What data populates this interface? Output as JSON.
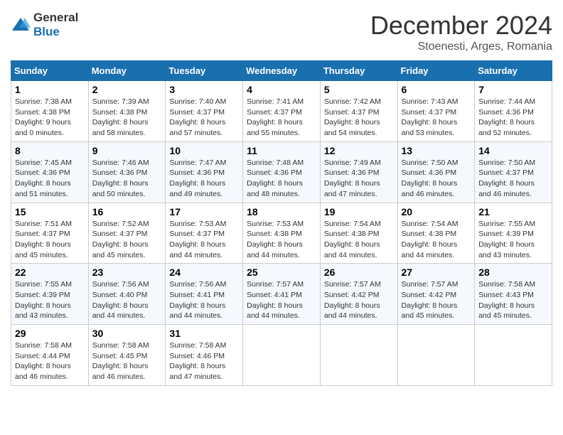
{
  "header": {
    "logo_general": "General",
    "logo_blue": "Blue",
    "month_title": "December 2024",
    "location": "Stoenesti, Arges, Romania"
  },
  "weekdays": [
    "Sunday",
    "Monday",
    "Tuesday",
    "Wednesday",
    "Thursday",
    "Friday",
    "Saturday"
  ],
  "weeks": [
    [
      {
        "day": 1,
        "sunrise": "Sunrise: 7:38 AM",
        "sunset": "Sunset: 4:38 PM",
        "daylight": "Daylight: 9 hours and 0 minutes."
      },
      {
        "day": 2,
        "sunrise": "Sunrise: 7:39 AM",
        "sunset": "Sunset: 4:38 PM",
        "daylight": "Daylight: 8 hours and 58 minutes."
      },
      {
        "day": 3,
        "sunrise": "Sunrise: 7:40 AM",
        "sunset": "Sunset: 4:37 PM",
        "daylight": "Daylight: 8 hours and 57 minutes."
      },
      {
        "day": 4,
        "sunrise": "Sunrise: 7:41 AM",
        "sunset": "Sunset: 4:37 PM",
        "daylight": "Daylight: 8 hours and 55 minutes."
      },
      {
        "day": 5,
        "sunrise": "Sunrise: 7:42 AM",
        "sunset": "Sunset: 4:37 PM",
        "daylight": "Daylight: 8 hours and 54 minutes."
      },
      {
        "day": 6,
        "sunrise": "Sunrise: 7:43 AM",
        "sunset": "Sunset: 4:37 PM",
        "daylight": "Daylight: 8 hours and 53 minutes."
      },
      {
        "day": 7,
        "sunrise": "Sunrise: 7:44 AM",
        "sunset": "Sunset: 4:36 PM",
        "daylight": "Daylight: 8 hours and 52 minutes."
      }
    ],
    [
      {
        "day": 8,
        "sunrise": "Sunrise: 7:45 AM",
        "sunset": "Sunset: 4:36 PM",
        "daylight": "Daylight: 8 hours and 51 minutes."
      },
      {
        "day": 9,
        "sunrise": "Sunrise: 7:46 AM",
        "sunset": "Sunset: 4:36 PM",
        "daylight": "Daylight: 8 hours and 50 minutes."
      },
      {
        "day": 10,
        "sunrise": "Sunrise: 7:47 AM",
        "sunset": "Sunset: 4:36 PM",
        "daylight": "Daylight: 8 hours and 49 minutes."
      },
      {
        "day": 11,
        "sunrise": "Sunrise: 7:48 AM",
        "sunset": "Sunset: 4:36 PM",
        "daylight": "Daylight: 8 hours and 48 minutes."
      },
      {
        "day": 12,
        "sunrise": "Sunrise: 7:49 AM",
        "sunset": "Sunset: 4:36 PM",
        "daylight": "Daylight: 8 hours and 47 minutes."
      },
      {
        "day": 13,
        "sunrise": "Sunrise: 7:50 AM",
        "sunset": "Sunset: 4:36 PM",
        "daylight": "Daylight: 8 hours and 46 minutes."
      },
      {
        "day": 14,
        "sunrise": "Sunrise: 7:50 AM",
        "sunset": "Sunset: 4:37 PM",
        "daylight": "Daylight: 8 hours and 46 minutes."
      }
    ],
    [
      {
        "day": 15,
        "sunrise": "Sunrise: 7:51 AM",
        "sunset": "Sunset: 4:37 PM",
        "daylight": "Daylight: 8 hours and 45 minutes."
      },
      {
        "day": 16,
        "sunrise": "Sunrise: 7:52 AM",
        "sunset": "Sunset: 4:37 PM",
        "daylight": "Daylight: 8 hours and 45 minutes."
      },
      {
        "day": 17,
        "sunrise": "Sunrise: 7:53 AM",
        "sunset": "Sunset: 4:37 PM",
        "daylight": "Daylight: 8 hours and 44 minutes."
      },
      {
        "day": 18,
        "sunrise": "Sunrise: 7:53 AM",
        "sunset": "Sunset: 4:38 PM",
        "daylight": "Daylight: 8 hours and 44 minutes."
      },
      {
        "day": 19,
        "sunrise": "Sunrise: 7:54 AM",
        "sunset": "Sunset: 4:38 PM",
        "daylight": "Daylight: 8 hours and 44 minutes."
      },
      {
        "day": 20,
        "sunrise": "Sunrise: 7:54 AM",
        "sunset": "Sunset: 4:38 PM",
        "daylight": "Daylight: 8 hours and 44 minutes."
      },
      {
        "day": 21,
        "sunrise": "Sunrise: 7:55 AM",
        "sunset": "Sunset: 4:39 PM",
        "daylight": "Daylight: 8 hours and 43 minutes."
      }
    ],
    [
      {
        "day": 22,
        "sunrise": "Sunrise: 7:55 AM",
        "sunset": "Sunset: 4:39 PM",
        "daylight": "Daylight: 8 hours and 43 minutes."
      },
      {
        "day": 23,
        "sunrise": "Sunrise: 7:56 AM",
        "sunset": "Sunset: 4:40 PM",
        "daylight": "Daylight: 8 hours and 44 minutes."
      },
      {
        "day": 24,
        "sunrise": "Sunrise: 7:56 AM",
        "sunset": "Sunset: 4:41 PM",
        "daylight": "Daylight: 8 hours and 44 minutes."
      },
      {
        "day": 25,
        "sunrise": "Sunrise: 7:57 AM",
        "sunset": "Sunset: 4:41 PM",
        "daylight": "Daylight: 8 hours and 44 minutes."
      },
      {
        "day": 26,
        "sunrise": "Sunrise: 7:57 AM",
        "sunset": "Sunset: 4:42 PM",
        "daylight": "Daylight: 8 hours and 44 minutes."
      },
      {
        "day": 27,
        "sunrise": "Sunrise: 7:57 AM",
        "sunset": "Sunset: 4:42 PM",
        "daylight": "Daylight: 8 hours and 45 minutes."
      },
      {
        "day": 28,
        "sunrise": "Sunrise: 7:58 AM",
        "sunset": "Sunset: 4:43 PM",
        "daylight": "Daylight: 8 hours and 45 minutes."
      }
    ],
    [
      {
        "day": 29,
        "sunrise": "Sunrise: 7:58 AM",
        "sunset": "Sunset: 4:44 PM",
        "daylight": "Daylight: 8 hours and 46 minutes."
      },
      {
        "day": 30,
        "sunrise": "Sunrise: 7:58 AM",
        "sunset": "Sunset: 4:45 PM",
        "daylight": "Daylight: 8 hours and 46 minutes."
      },
      {
        "day": 31,
        "sunrise": "Sunrise: 7:58 AM",
        "sunset": "Sunset: 4:46 PM",
        "daylight": "Daylight: 8 hours and 47 minutes."
      },
      null,
      null,
      null,
      null
    ]
  ]
}
